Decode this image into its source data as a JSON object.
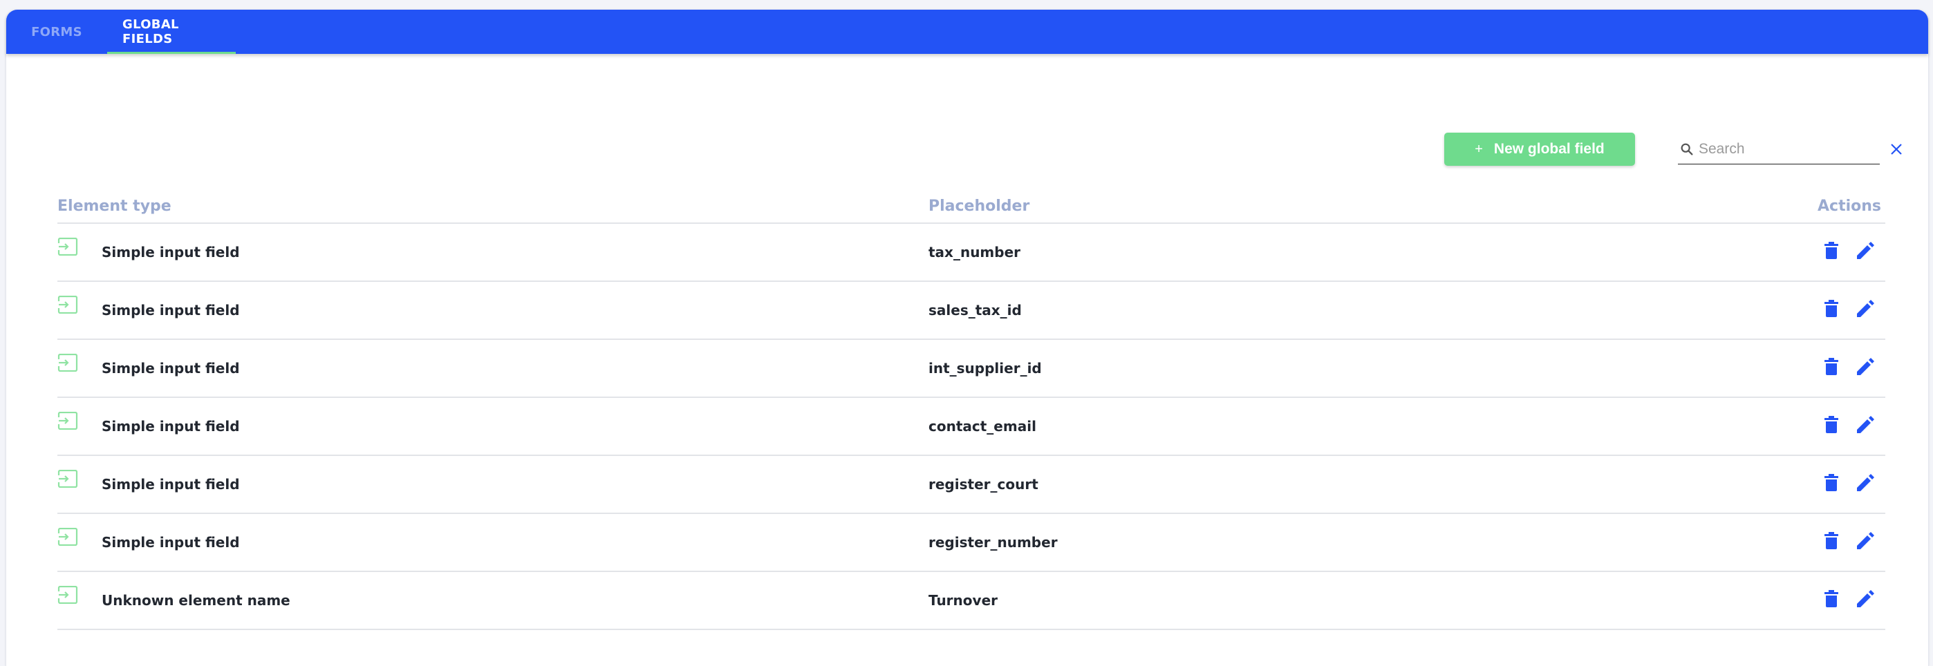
{
  "tabs": [
    {
      "label": "FORMS",
      "active": false
    },
    {
      "label": "GLOBAL FIELDS",
      "active": true
    }
  ],
  "toolbar": {
    "new_button_icon": "+",
    "new_button_label": "New global field",
    "search_placeholder": "Search",
    "search_value": ""
  },
  "table": {
    "columns": {
      "element_type": "Element type",
      "placeholder": "Placeholder",
      "actions": "Actions"
    },
    "rows": [
      {
        "element_type": "Simple input field",
        "placeholder": "tax_number"
      },
      {
        "element_type": "Simple input field",
        "placeholder": "sales_tax_id"
      },
      {
        "element_type": "Simple input field",
        "placeholder": "int_supplier_id"
      },
      {
        "element_type": "Simple input field",
        "placeholder": "contact_email"
      },
      {
        "element_type": "Simple input field",
        "placeholder": "register_court"
      },
      {
        "element_type": "Simple input field",
        "placeholder": "register_number"
      },
      {
        "element_type": "Unknown element name",
        "placeholder": "Turnover"
      }
    ]
  },
  "icons": {
    "row_type": "input-field-icon",
    "delete": "trash-icon",
    "edit": "pencil-icon",
    "search": "search-icon",
    "clear": "close-icon"
  },
  "colors": {
    "primary": "#2353f5",
    "accent_green": "#6fdb8d",
    "header_text": "#9aaad0"
  }
}
